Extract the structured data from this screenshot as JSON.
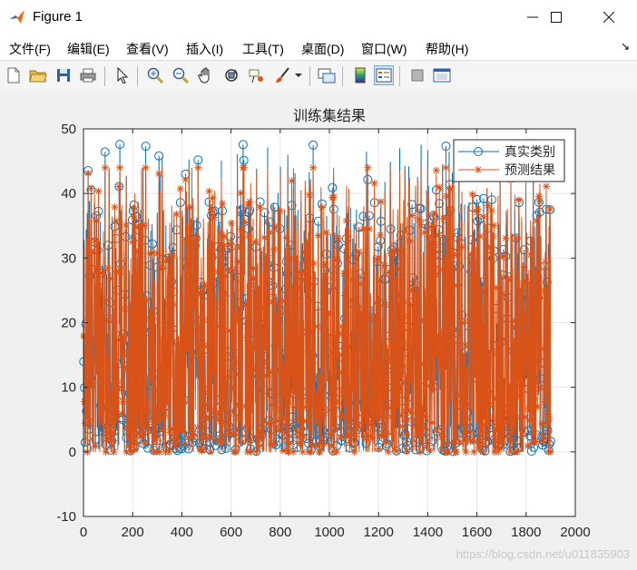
{
  "window": {
    "title": "Figure 1"
  },
  "menu": [
    {
      "label": "文件(F)",
      "name": "menu-file"
    },
    {
      "label": "编辑(E)",
      "name": "menu-edit"
    },
    {
      "label": "查看(V)",
      "name": "menu-view"
    },
    {
      "label": "插入(I)",
      "name": "menu-insert"
    },
    {
      "label": "工具(T)",
      "name": "menu-tools"
    },
    {
      "label": "桌面(D)",
      "name": "menu-desktop"
    },
    {
      "label": "窗口(W)",
      "name": "menu-window"
    },
    {
      "label": "帮助(H)",
      "name": "menu-help"
    }
  ],
  "toolbar": [
    "new-figure-icon",
    "open-file-icon",
    "save-icon",
    "print-icon",
    "select-arrow-icon",
    "zoom-in-icon",
    "zoom-out-icon",
    "pan-hand-icon",
    "rotate-3d-icon",
    "data-cursor-icon",
    "brush-icon",
    "link-plot-icon",
    "colorbar-icon",
    "legend-icon",
    "hide-plot-tools-icon",
    "show-plot-tools-icon"
  ],
  "colors": {
    "series1": "#0072bd",
    "series2": "#d95319",
    "axes_bg": "#ffffff",
    "grid": "#e6e6e6"
  },
  "watermark": "https://blog.csdn.net/u011835903",
  "chart_data": {
    "type": "line",
    "title": "训练集结果",
    "xlabel": "",
    "ylabel": "",
    "xlim": [
      0,
      2000
    ],
    "ylim": [
      -10,
      50
    ],
    "xticks": [
      0,
      200,
      400,
      600,
      800,
      1000,
      1200,
      1400,
      1600,
      1800,
      2000
    ],
    "yticks": [
      -10,
      0,
      10,
      20,
      30,
      40,
      50
    ],
    "grid": true,
    "legend_position": "top-right",
    "series": [
      {
        "name": "真实类别",
        "marker": "o",
        "color": "#0072bd",
        "n_points": 1900,
        "value_range": [
          0,
          49
        ],
        "note": "dense noisy data, per-point values not legible"
      },
      {
        "name": "预测结果",
        "marker": "*",
        "color": "#d95319",
        "n_points": 1900,
        "value_range": [
          0,
          44
        ],
        "note": "dense noisy data, per-point values not legible"
      }
    ]
  }
}
